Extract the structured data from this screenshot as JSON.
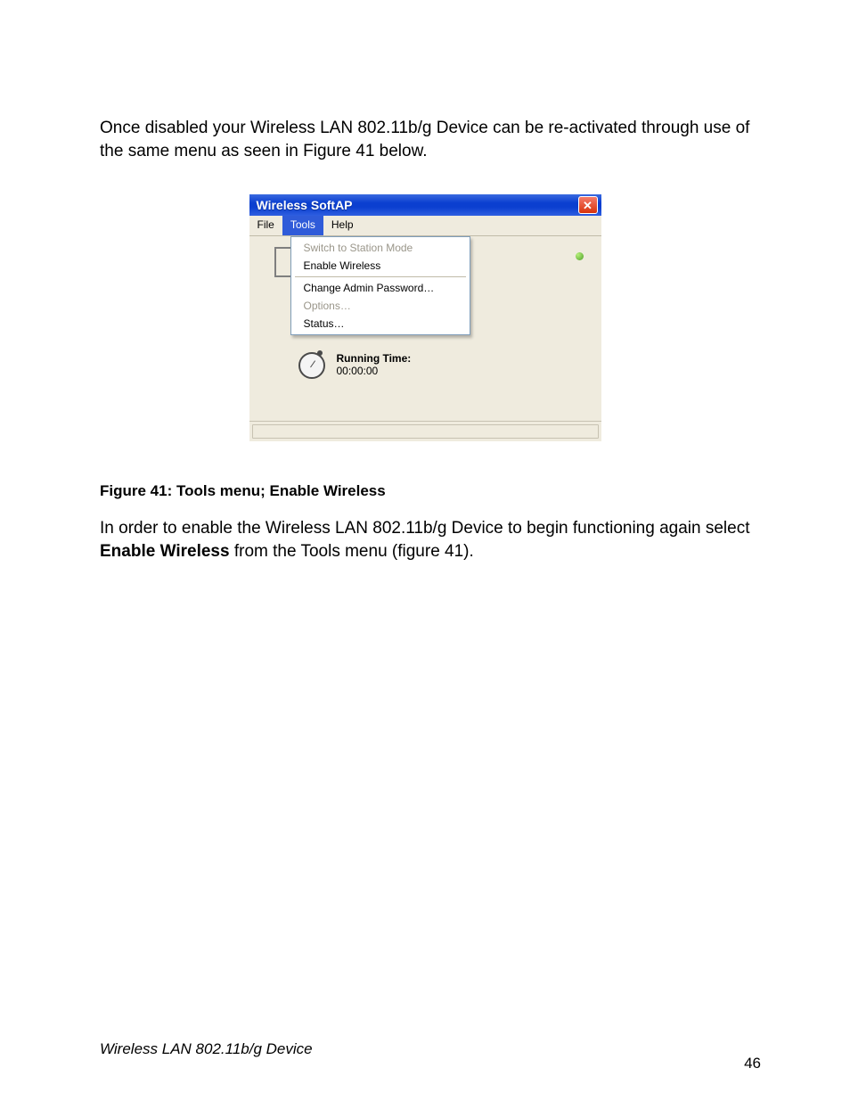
{
  "doc": {
    "para1": "Once disabled your Wireless LAN 802.11b/g Device can be re-activated through use of the same menu as seen in Figure 41 below.",
    "figure_caption": "Figure 41: Tools menu; Enable Wireless",
    "para2_a": "In order to enable the Wireless LAN 802.11b/g Device to begin functioning again select ",
    "para2_bold": "Enable Wireless",
    "para2_b": " from the Tools menu (figure 41).",
    "footer_left": "Wireless LAN 802.11b/g Device",
    "footer_right": "46"
  },
  "window": {
    "title": "Wireless SoftAP",
    "close_glyph": "✕",
    "menubar": {
      "file": "File",
      "tools": "Tools",
      "help": "Help"
    },
    "tools_menu": {
      "switch_station": "Switch to Station Mode",
      "enable_wireless": "Enable Wireless",
      "change_pw": "Change Admin Password…",
      "options": "Options…",
      "status": "Status…"
    },
    "running_time_label": "Running Time:",
    "running_time_value": "00:00:00"
  }
}
